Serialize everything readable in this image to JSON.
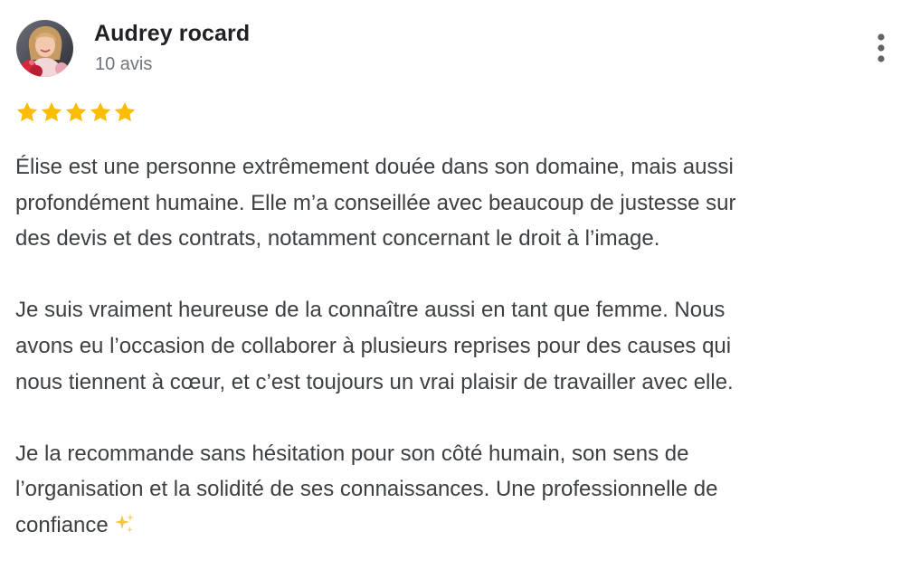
{
  "review": {
    "author_name": "Audrey rocard",
    "review_count": "10 avis",
    "rating": 5,
    "rating_max": 5,
    "avatar_icon": "profile-photo",
    "more_icon": "more-vertical-icon",
    "star_color": "#fbbc04",
    "paragraphs": [
      {
        "lines": [
          "Élise est une personne extrêmement douée dans son domaine, mais aussi",
          "profondément humaine. Elle m’a conseillée avec beaucoup de justesse sur",
          "des devis et des contrats, notamment concernant le droit à l’image."
        ]
      },
      {
        "lines": [
          "Je suis vraiment heureuse de la connaître aussi en tant que femme. Nous",
          "avons eu l’occasion de collaborer à plusieurs reprises pour des causes qui",
          "nous tiennent à cœur, et c’est toujours un vrai plaisir de travailler avec elle."
        ]
      },
      {
        "lines": [
          "Je la recommande sans hésitation pour son côté humain, son sens de",
          "l’organisation et la solidité de ses connaissances. Une professionnelle de",
          "confiance"
        ],
        "trailing_icon": "sparkles-icon"
      }
    ]
  }
}
